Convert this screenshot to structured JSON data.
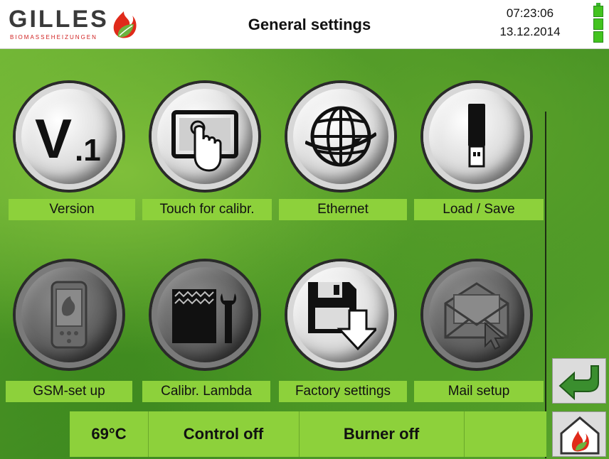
{
  "header": {
    "logo_text": "GILLES",
    "logo_subtext": "BIOMASSEHEIZUNGEN",
    "title": "General settings",
    "time": "07:23:06",
    "date": "13.12.2014"
  },
  "tiles": [
    {
      "label": "Version",
      "icon": "version-icon"
    },
    {
      "label": "Touch for calibr.",
      "icon": "touch-calibrate-icon"
    },
    {
      "label": "Ethernet",
      "icon": "globe-icon"
    },
    {
      "label": "Load / Save",
      "icon": "usb-stick-icon"
    },
    {
      "label": "GSM-set up",
      "icon": "phone-icon"
    },
    {
      "label": "Calibr. Lambda",
      "icon": "lambda-wrench-icon"
    },
    {
      "label": "Factory settings",
      "icon": "floppy-download-icon"
    },
    {
      "label": "Mail setup",
      "icon": "mail-icon"
    }
  ],
  "status": {
    "temperature": "69°C",
    "control": "Control off",
    "burner": "Burner off",
    "extra": ""
  },
  "side_buttons": {
    "back": "back-arrow-icon",
    "home": "home-flame-icon"
  },
  "colors": {
    "label_green": "#8dd13b",
    "battery_green": "#43c31f",
    "flame_red": "#e02a1a"
  }
}
